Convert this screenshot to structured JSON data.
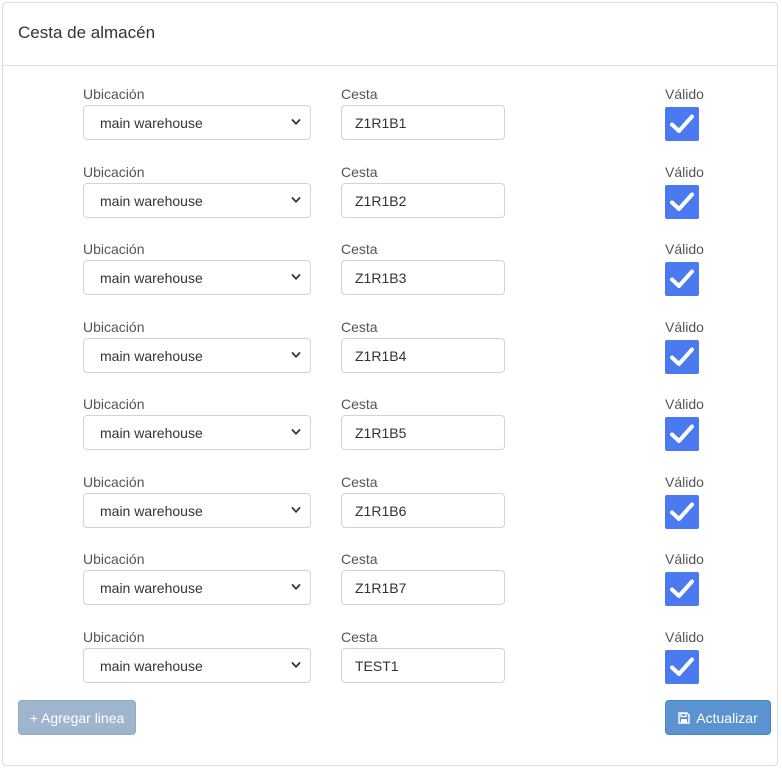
{
  "card": {
    "title": "Cesta de almacén"
  },
  "labels": {
    "ubicacion": "Ubicación",
    "cesta": "Cesta",
    "valido": "Válido"
  },
  "rows": [
    {
      "location": "main warehouse",
      "basket": "Z1R1B1",
      "valid": true
    },
    {
      "location": "main warehouse",
      "basket": "Z1R1B2",
      "valid": true
    },
    {
      "location": "main warehouse",
      "basket": "Z1R1B3",
      "valid": true
    },
    {
      "location": "main warehouse",
      "basket": "Z1R1B4",
      "valid": true
    },
    {
      "location": "main warehouse",
      "basket": "Z1R1B5",
      "valid": true
    },
    {
      "location": "main warehouse",
      "basket": "Z1R1B6",
      "valid": true
    },
    {
      "location": "main warehouse",
      "basket": "Z1R1B7",
      "valid": true
    },
    {
      "location": "main warehouse",
      "basket": "TEST1",
      "valid": true
    }
  ],
  "buttons": {
    "add_line": "+ Agregar linea",
    "update": "Actualizar"
  },
  "icons": {
    "dropdown": "chevron-down-icon",
    "checkbox": "check-icon",
    "save": "save-icon"
  },
  "colors": {
    "checkbox": "#4a79f0",
    "add_button": "#9eb5cd",
    "update_button": "#5b93d1"
  }
}
